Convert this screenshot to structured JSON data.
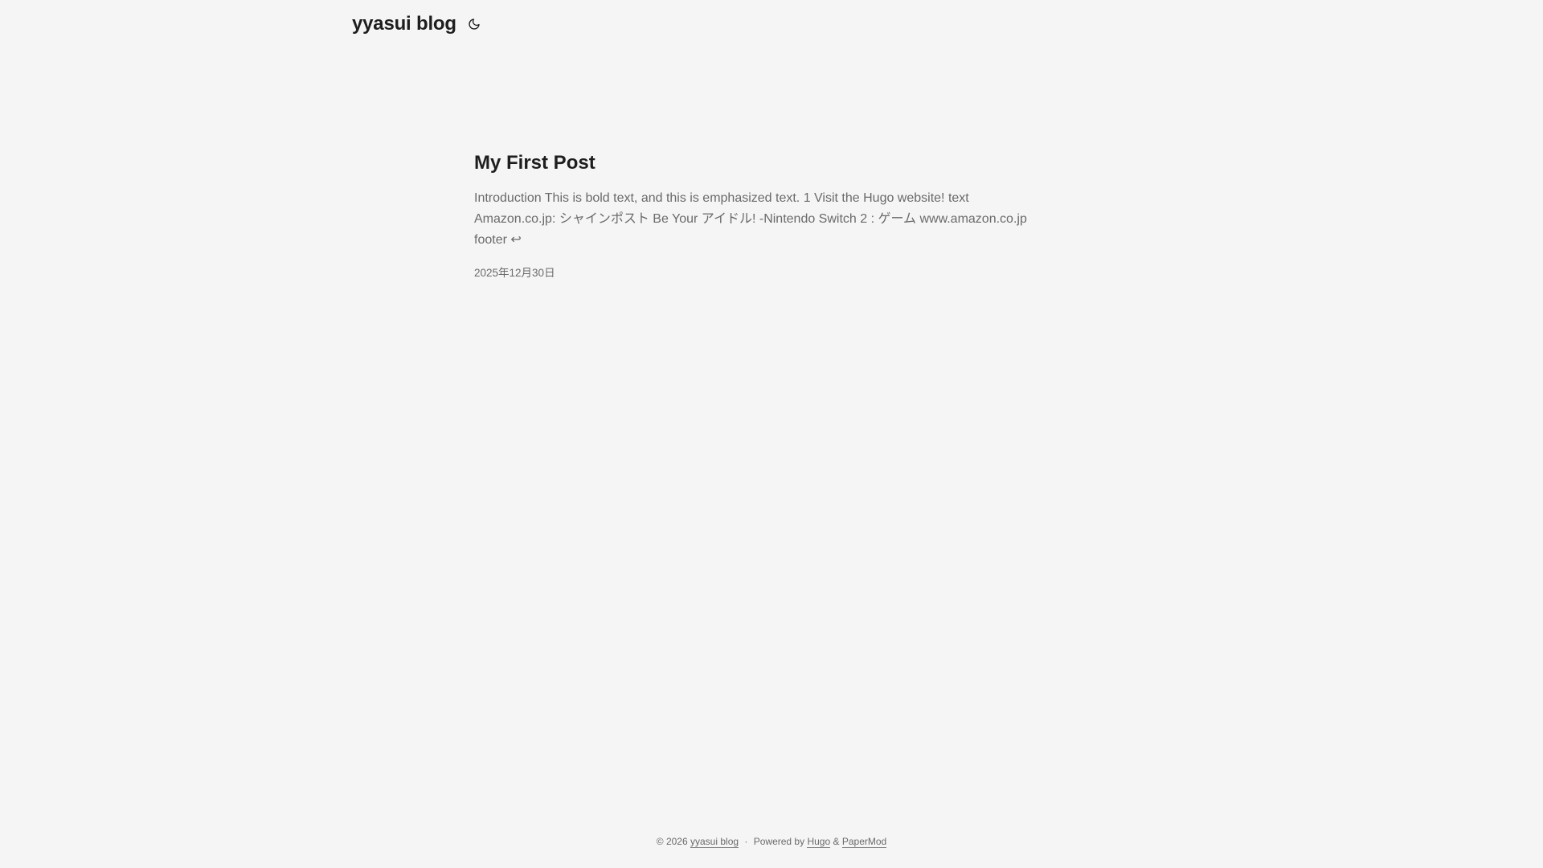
{
  "header": {
    "logo": "yyasui blog",
    "theme_icon": "moon-icon"
  },
  "post": {
    "title": "My First Post",
    "summary": "Introduction This is bold text, and this is emphasized text. 1 Visit the Hugo website! text Amazon.co.jp: シャインポスト Be Your アイドル! -Nintendo Switch 2 : ゲーム www.amazon.co.jp footer ↩",
    "date": "2025年12月30日"
  },
  "footer": {
    "copyright": "© 2026",
    "site_link": "yyasui blog",
    "separator": "·",
    "powered_by": "Powered by",
    "hugo_link": "Hugo",
    "ampersand": "&",
    "theme_link": "PaperMod"
  }
}
